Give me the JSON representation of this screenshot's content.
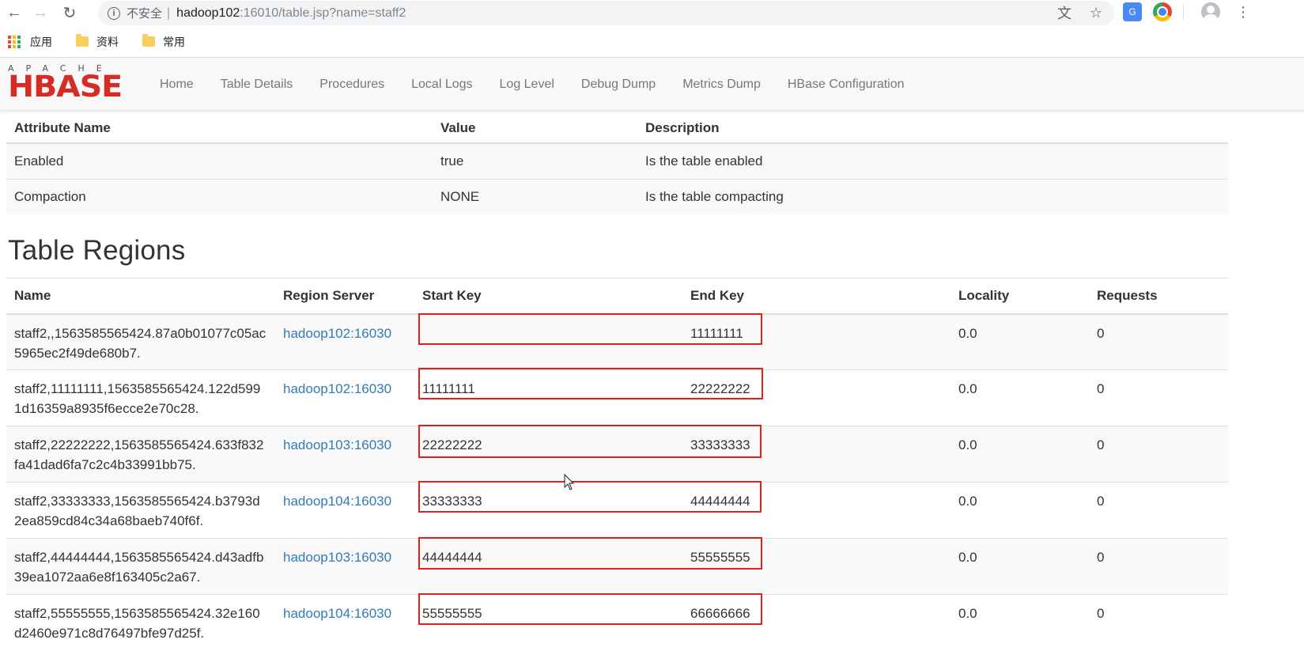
{
  "browser": {
    "insecure_label": "不安全",
    "url_host": "hadoop102",
    "url_rest": ":16010/table.jsp?name=staff2",
    "bookmarks": [
      "应用",
      "资料",
      "常用"
    ]
  },
  "hbase": {
    "logo_top": "APACHE",
    "logo_main": "HBASE",
    "nav": [
      "Home",
      "Table Details",
      "Procedures",
      "Local Logs",
      "Log Level",
      "Debug Dump",
      "Metrics Dump",
      "HBase Configuration"
    ]
  },
  "attributes": {
    "headers": [
      "Attribute Name",
      "Value",
      "Description"
    ],
    "rows": [
      [
        "Enabled",
        "true",
        "Is the table enabled"
      ],
      [
        "Compaction",
        "NONE",
        "Is the table compacting"
      ]
    ]
  },
  "regions": {
    "title": "Table Regions",
    "headers": [
      "Name",
      "Region Server",
      "Start Key",
      "End Key",
      "Locality",
      "Requests"
    ],
    "rows": [
      {
        "name": "staff2,,1563585565424.87a0b01077c05ac5965ec2f49de680b7.",
        "server": "hadoop102:16030",
        "start": "",
        "end": "11111111",
        "locality": "0.0",
        "requests": "0"
      },
      {
        "name": "staff2,11111111,1563585565424.122d5991d16359a8935f6ecce2e70c28.",
        "server": "hadoop102:16030",
        "start": "11111111",
        "end": "22222222",
        "locality": "0.0",
        "requests": "0"
      },
      {
        "name": "staff2,22222222,1563585565424.633f832fa41dad6fa7c2c4b33991bb75.",
        "server": "hadoop103:16030",
        "start": "22222222",
        "end": "33333333",
        "locality": "0.0",
        "requests": "0"
      },
      {
        "name": "staff2,33333333,1563585565424.b3793d2ea859cd84c34a68baeb740f6f.",
        "server": "hadoop104:16030",
        "start": "33333333",
        "end": "44444444",
        "locality": "0.0",
        "requests": "0"
      },
      {
        "name": "staff2,44444444,1563585565424.d43adfb39ea1072aa6e8f163405c2a67.",
        "server": "hadoop103:16030",
        "start": "44444444",
        "end": "55555555",
        "locality": "0.0",
        "requests": "0"
      },
      {
        "name": "staff2,55555555,1563585565424.32e160d2460e971c8d76497bfe97d25f.",
        "server": "hadoop104:16030",
        "start": "55555555",
        "end": "66666666",
        "locality": "0.0",
        "requests": "0"
      }
    ]
  }
}
